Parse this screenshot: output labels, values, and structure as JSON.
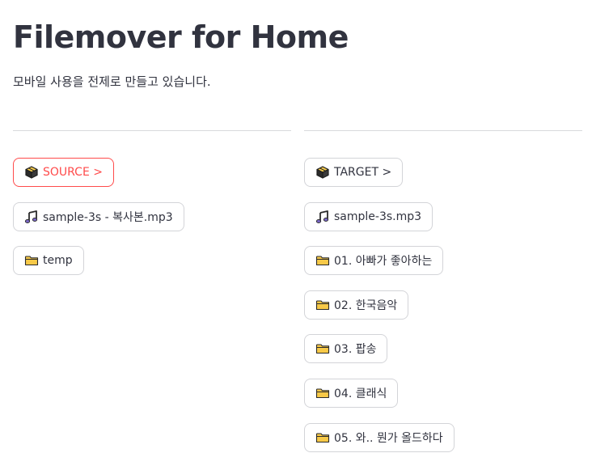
{
  "app": {
    "title": "Filemover for Home",
    "subtitle": "모바일 사용을 전제로 만들고 있습니다."
  },
  "source": {
    "header": {
      "label": "SOURCE >",
      "icon": "package-icon"
    },
    "items": [
      {
        "label": "sample-3s - 복사본.mp3",
        "icon": "music-note-icon"
      },
      {
        "label": "temp",
        "icon": "folder-icon"
      }
    ]
  },
  "target": {
    "header": {
      "label": "TARGET >",
      "icon": "package-icon"
    },
    "items": [
      {
        "label": "sample-3s.mp3",
        "icon": "music-note-icon"
      },
      {
        "label": "01. 아빠가 좋아하는",
        "icon": "folder-icon"
      },
      {
        "label": "02. 한국음악",
        "icon": "folder-icon"
      },
      {
        "label": "03. 팝송",
        "icon": "folder-icon"
      },
      {
        "label": "04. 클래식",
        "icon": "folder-icon"
      },
      {
        "label": "05. 와.. 뭔가 올드하다",
        "icon": "folder-icon"
      }
    ]
  },
  "colors": {
    "accent": "#ff4b4b",
    "text": "#31333f",
    "border": "#d3d4d8"
  }
}
